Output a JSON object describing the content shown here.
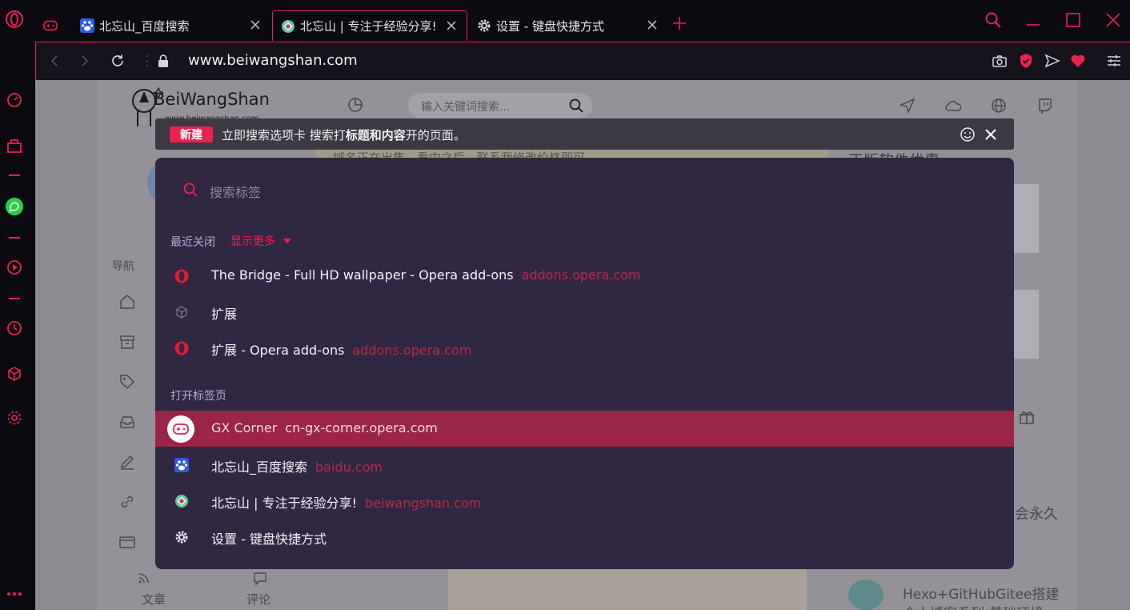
{
  "colors": {
    "accent": "#e8234f",
    "panel": "#302841",
    "selected_row": "#9a2548",
    "domain_text": "#b8294a"
  },
  "tabs": [
    {
      "title": "",
      "icon": "gamepad-icon"
    },
    {
      "title": "北忘山_百度搜索",
      "icon": "baidu-paw-icon"
    },
    {
      "title": "北忘山 | 专注于经验分享!",
      "icon": "beiwangshan-icon"
    },
    {
      "title": "设置 - 键盘快捷方式",
      "icon": "gear-icon"
    }
  ],
  "address_bar": {
    "url": "www.beiwangshan.com"
  },
  "page_bg": {
    "logo_text": "BeiWangShan",
    "logo_sub": "www.beiwangshan.com",
    "search_placeholder": "输入关键词搜索...",
    "nav_label": "导航",
    "marquee": "域名正在出售，看中之后，联系我修改价格即可",
    "right_title": "正版软件优惠",
    "right_snippet": "会永久",
    "article_label": "文章",
    "comment_label": "评论",
    "hexo_title": "Hexo+GitHubGitee搭建",
    "hexo_sub": "个人博客系列-基础环境"
  },
  "notice": {
    "badge": "新建",
    "text_part1": "立即搜索选项卡 搜索打",
    "text_bold": "标题和内容",
    "text_part2": "开的页面。"
  },
  "tab_search": {
    "placeholder": "搜索标签",
    "recently_closed_label": "最近关闭",
    "show_more_label": "显示更多",
    "open_tabs_label": "打开标签页",
    "recently_closed": [
      {
        "title": "The Bridge - Full HD wallpaper - Opera add-ons",
        "domain": "addons.opera.com",
        "icon": "opera-icon"
      },
      {
        "title": "扩展",
        "domain": "",
        "icon": "cube-icon"
      },
      {
        "title": "扩展 - Opera add-ons",
        "domain": "addons.opera.com",
        "icon": "opera-icon"
      }
    ],
    "open_tabs": [
      {
        "title": "GX Corner",
        "domain": "cn-gx-corner.opera.com",
        "icon": "gamepad-icon",
        "selected": true
      },
      {
        "title": "北忘山_百度搜索",
        "domain": "baidu.com",
        "icon": "baidu-paw-icon"
      },
      {
        "title": "北忘山 | 专注于经验分享!",
        "domain": "beiwangshan.com",
        "icon": "beiwangshan-icon"
      },
      {
        "title": "设置 - 键盘快捷方式",
        "domain": "",
        "icon": "gear-icon"
      }
    ]
  }
}
